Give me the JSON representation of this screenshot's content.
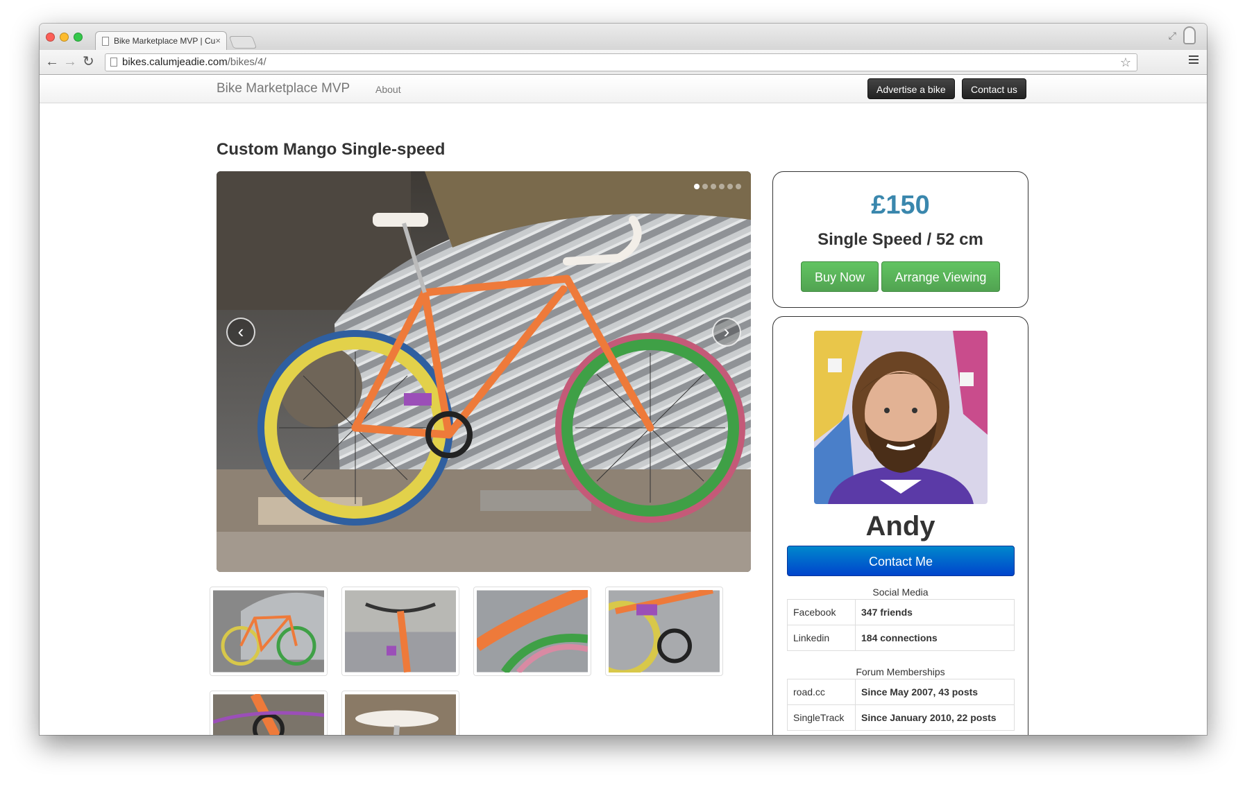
{
  "browser": {
    "tab_title": "Bike Marketplace MVP | Cu",
    "tab_close": "×",
    "url_domain": "bikes.calumjeadie.com",
    "url_path": "/bikes/4/",
    "back_icon": "←",
    "forward_icon": "→",
    "reload_icon": "↻",
    "star_icon": "☆",
    "resize_icon": "⤢"
  },
  "navbar": {
    "brand": "Bike Marketplace MVP",
    "about": "About",
    "advertise": "Advertise a bike",
    "contact": "Contact us"
  },
  "listing": {
    "title": "Custom Mango Single-speed",
    "carousel_prev": "‹",
    "carousel_next": "›",
    "slide_count": 6,
    "active_slide": 1,
    "thumbnail_count": 6
  },
  "price_card": {
    "price": "£150",
    "spec": "Single Speed / 52 cm",
    "buy_now": "Buy Now",
    "arrange_viewing": "Arrange Viewing"
  },
  "seller_card": {
    "name": "Andy",
    "contact_button": "Contact Me",
    "social_heading": "Social Media",
    "social": [
      {
        "network": "Facebook",
        "value": "347 friends"
      },
      {
        "network": "Linkedin",
        "value": "184 connections"
      }
    ],
    "forum_heading": "Forum Memberships",
    "forums": [
      {
        "forum": "road.cc",
        "value": "Since May 2007, 43 posts"
      },
      {
        "forum": "SingleTrack",
        "value": "Since January 2010, 22 posts"
      }
    ]
  },
  "colors": {
    "price": "#3a87ad",
    "green_button": "#5bb75b",
    "blue_button": "#0066cc",
    "bike_frame": "#ee7a3a"
  }
}
